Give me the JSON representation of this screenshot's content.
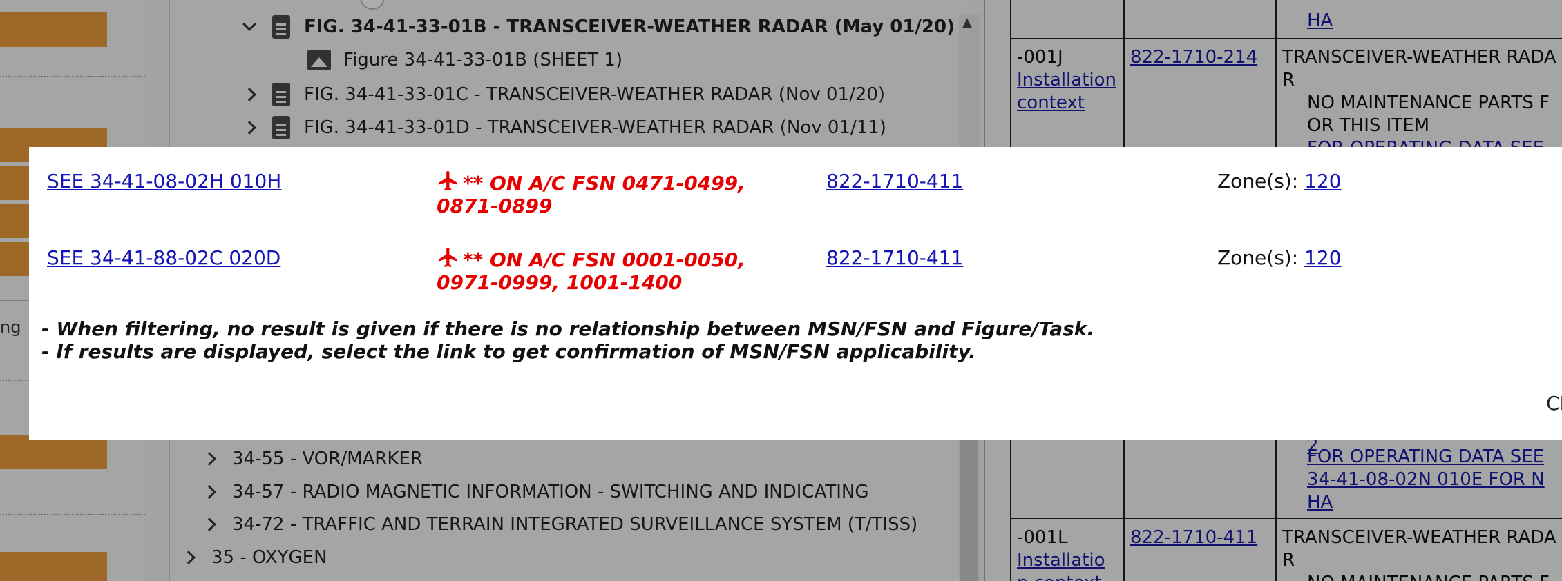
{
  "left_sidebar": {
    "partial_text": "ng"
  },
  "tree": {
    "rows": [
      {
        "label": "FIG. 34-41-33-01B - TRANSCEIVER-WEATHER RADAR (May 01/20)",
        "expanded": true
      },
      {
        "label": "Figure 34-41-33-01B (SHEET 1)"
      },
      {
        "label": "FIG. 34-41-33-01C - TRANSCEIVER-WEATHER RADAR (Nov 01/20)"
      },
      {
        "label": "FIG. 34-41-33-01D - TRANSCEIVER-WEATHER RADAR (Nov 01/11)"
      },
      {
        "label": "34-55 - VOR/MARKER"
      },
      {
        "label": "34-57 - RADIO MAGNETIC INFORMATION - SWITCHING AND INDICATING"
      },
      {
        "label": "34-72 - TRAFFIC AND TERRAIN INTEGRATED SURVEILLANCE SYSTEM (T/TISS)"
      },
      {
        "label": "35 - OXYGEN"
      }
    ]
  },
  "table": {
    "top_link": "HA",
    "row_001J": {
      "item": "-001J",
      "context_link": "Installation context",
      "part_number": "822-1710-214",
      "desc_line1": "TRANSCEIVER-WEATHER RADA",
      "desc_line2": "R",
      "note_line1": "NO MAINTENANCE PARTS F",
      "note_line2": "OR THIS ITEM",
      "op_data_partial": "FOR OPERATING DATA SEE"
    },
    "mid_partial_link": "2",
    "op_data": {
      "line1": "FOR OPERATING DATA SEE",
      "line2": "34-41-08-02N 010E FOR N",
      "line3": "HA"
    },
    "row_001L": {
      "item": "-001L",
      "context_link_line1": "Installatio",
      "context_link_line2": "n context",
      "part_number": "822-1710-411",
      "desc_line1": "TRANSCEIVER-WEATHER RADA",
      "desc_line2": "R",
      "note_partial": "NO MAINTENANCE PARTS F"
    }
  },
  "modal": {
    "rows": [
      {
        "see_link": "SEE 34-41-08-02H 010H",
        "applicability": "** ON A/C FSN 0471-0499, 0871-0899",
        "part_number": "822-1710-411",
        "zone_label": "Zone(s):",
        "zone_value": "120"
      },
      {
        "see_link": "SEE 34-41-88-02C 020D",
        "applicability": "** ON A/C FSN 0001-0050, 0971-0999, 1001-1400",
        "part_number": "822-1710-411",
        "zone_label": "Zone(s):",
        "zone_value": "120"
      }
    ],
    "note1": "- When filtering, no result is given if there is no relationship between MSN/FSN and Figure/Task.",
    "note2": "- If results are displayed, select the link to get confirmation of MSN/FSN applicability.",
    "close_label": "CLOSE"
  },
  "colors": {
    "accent_orange": "#e89a3c",
    "link_blue": "#1515b5",
    "applicability_red": "#e60000"
  },
  "icons": [
    "chevron-down-icon",
    "chevron-right-icon",
    "document-icon",
    "image-icon",
    "airplane-icon",
    "scroll-up-icon"
  ]
}
